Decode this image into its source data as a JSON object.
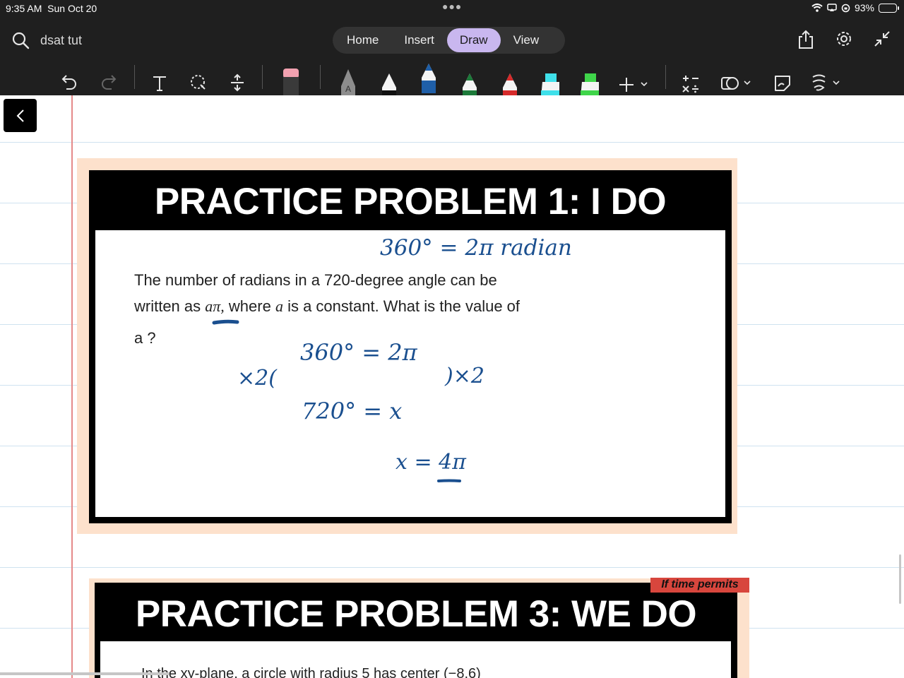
{
  "status_bar": {
    "time": "9:35 AM",
    "date": "Sun Oct 20",
    "battery": "93%"
  },
  "header": {
    "notebook_title": "dsat tut"
  },
  "tabs": [
    {
      "label": "Home"
    },
    {
      "label": "Insert"
    },
    {
      "label": "Draw",
      "active": true
    },
    {
      "label": "View"
    }
  ],
  "pen_colors": {
    "pencil": "#9a9a9a",
    "black_pen": "#111111",
    "blue_pen": "#1f5fa8",
    "green_pen": "#1d7a3a",
    "red_pen": "#d62b2b",
    "cyan_highlighter": "#3fe0ea",
    "green_highlighter": "#3fd54a",
    "eraser": "#f2a1b0"
  },
  "slide1": {
    "title": "PRACTICE PROBLEM 1: I DO",
    "text_line1": "The number of radians in a 720-degree angle can be",
    "text_line2_a": "written as ",
    "text_math": "aπ,",
    "text_line2_b": " where ",
    "text_var": "a",
    "text_line2_c": " is a constant. What is the value of",
    "text_line3": "a ?"
  },
  "ink": {
    "note1": "360° = 2π radian",
    "left_mult": "×2(",
    "line_a": "360° = 2π",
    "right_mult": ")×2",
    "line_b": "720° = x",
    "answer": "x = 4π"
  },
  "slide3": {
    "badge": "If time permits",
    "title": "PRACTICE PROBLEM 3: WE DO",
    "text": "In the xy-plane, a circle with radius 5 has center (−8,6)"
  }
}
